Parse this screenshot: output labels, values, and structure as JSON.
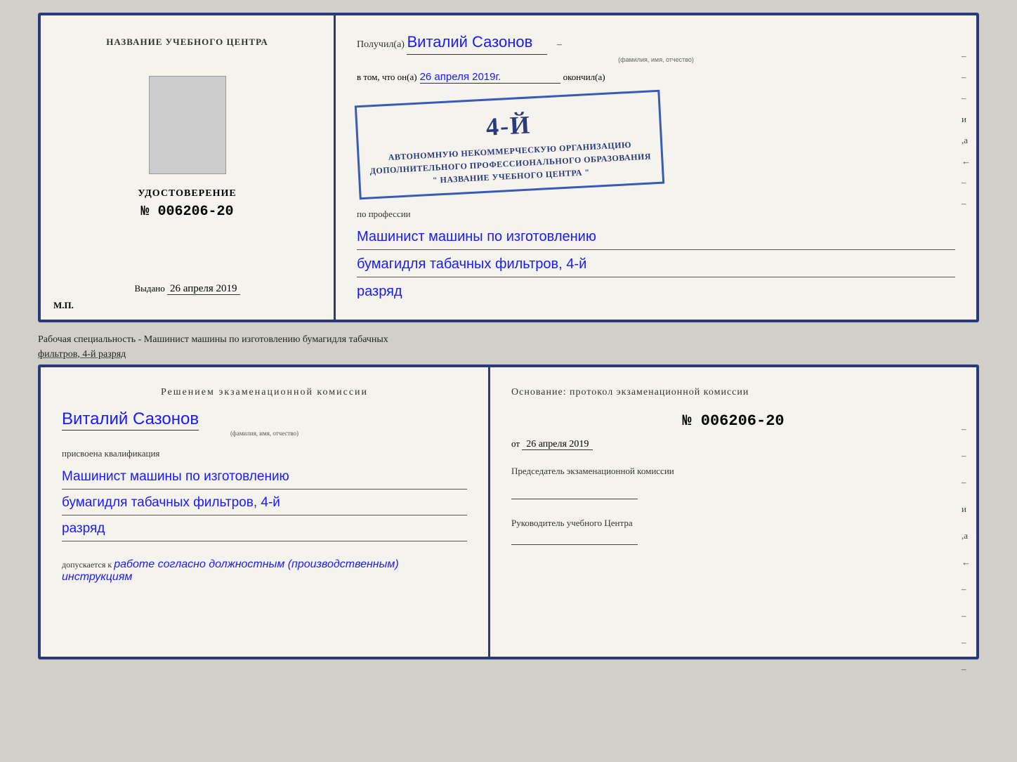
{
  "page": {
    "bg_color": "#d0cfc8"
  },
  "top_doc": {
    "left": {
      "center_label": "НАЗВАНИЕ УЧЕБНОГО ЦЕНТРА",
      "udost_title": "УДОСТОВЕРЕНИЕ",
      "udost_number": "№ 006206-20",
      "vydano_prefix": "Выдано",
      "vydano_date": "26 апреля 2019",
      "mp_label": "М.П."
    },
    "right": {
      "received_prefix": "Получил(а)",
      "recipient_name": "Виталий Сазонов",
      "recipient_sub": "(фамилия, имя, отчество)",
      "vtom_prefix": "в том, что он(а)",
      "vtom_date": "26 апреля 2019г.",
      "okончил_suffix": "окончил(а)",
      "stamp_line1": "4-й",
      "stamp_line2": "АВТОНОМНУЮ НЕКОММЕРЧЕСКУЮ ОРГАНИЗАЦИЮ",
      "stamp_line3": "ДОПОЛНИТЕЛЬНОГО ПРОФЕССИОНАЛЬНОГО ОБРАЗОВАНИЯ",
      "stamp_line4": "\" НАЗВАНИЕ УЧЕБНОГО ЦЕНТРА \"",
      "po_professii_label": "по профессии",
      "profession_line1": "Машинист машины по изготовлению",
      "profession_line2": "бумагидля табачных фильтров, 4-й",
      "profession_line3": "разряд",
      "dashes": [
        "-",
        "-",
        "-",
        "и",
        ",а",
        "←",
        "-",
        "-",
        "-",
        "-"
      ]
    }
  },
  "specialty_label": {
    "text": "Рабочая специальность - Машинист машины по изготовлению бумагидля табачных",
    "text2": "фильтров, 4-й разряд"
  },
  "bottom_doc": {
    "left": {
      "reshen_title": "Решением  экзаменационной  комиссии",
      "name": "Виталий Сазонов",
      "name_sub": "(фамилия, имя, отчество)",
      "prisvoena": "присвоена квалификация",
      "qual_line1": "Машинист машины по изготовлению",
      "qual_line2": "бумагидля табачных фильтров, 4-й",
      "qual_line3": "разряд",
      "dopusk_prefix": "допускается к",
      "dopusk_text": "работе согласно должностным (производственным) инструкциям"
    },
    "right": {
      "osnov_title": "Основание:  протокол  экзаменационной  комиссии",
      "protocol_number": "№  006206-20",
      "ot_prefix": "от",
      "ot_date": "26 апреля 2019",
      "predsedatel_label": "Председатель экзаменационной комиссии",
      "rukovoditel_label": "Руководитель учебного Центра",
      "dashes": [
        "-",
        "-",
        "-",
        "и",
        ",а",
        "←",
        "-",
        "-",
        "-",
        "-"
      ]
    }
  }
}
